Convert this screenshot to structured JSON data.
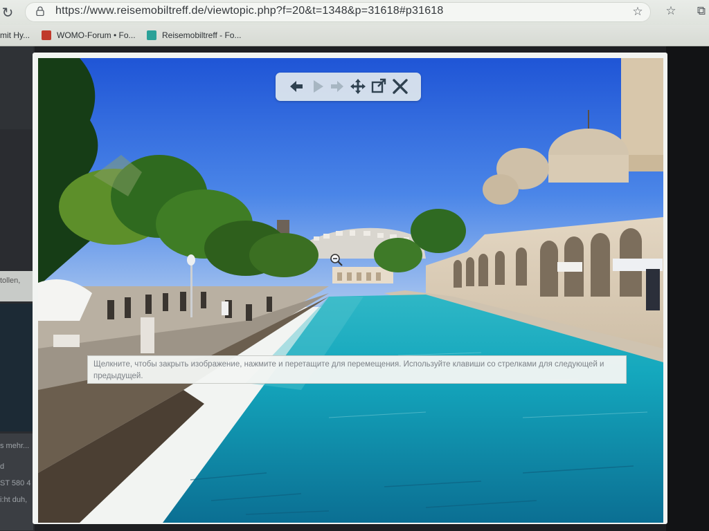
{
  "browser": {
    "url": "https://www.reisemobiltreff.de/viewtopic.php?f=20&t=1348&p=31618#p31618",
    "icons": [
      "reload-icon",
      "lock-icon",
      "favorite-add-icon",
      "favorites-icon",
      "collections-icon"
    ],
    "bookmarks": [
      {
        "label": "mit Hy..."
      },
      {
        "label": "WOMO-Forum • Fo..."
      },
      {
        "label": "Reisemobiltreff - Fo..."
      }
    ]
  },
  "background_page": {
    "snippets": [
      "tollen,",
      "s mehr...",
      "d",
      "ST 580 4",
      "i:ht duh,"
    ]
  },
  "lightbox": {
    "controls": [
      "previous-icon",
      "play-icon",
      "next-icon",
      "move-icon",
      "open-original-icon",
      "close-icon"
    ],
    "caption": "Щелкните, чтобы закрыть изображение, нажмите и перетащите для перемещения. Используйте клавиши со стрелками для следующей и предыдущей."
  }
}
